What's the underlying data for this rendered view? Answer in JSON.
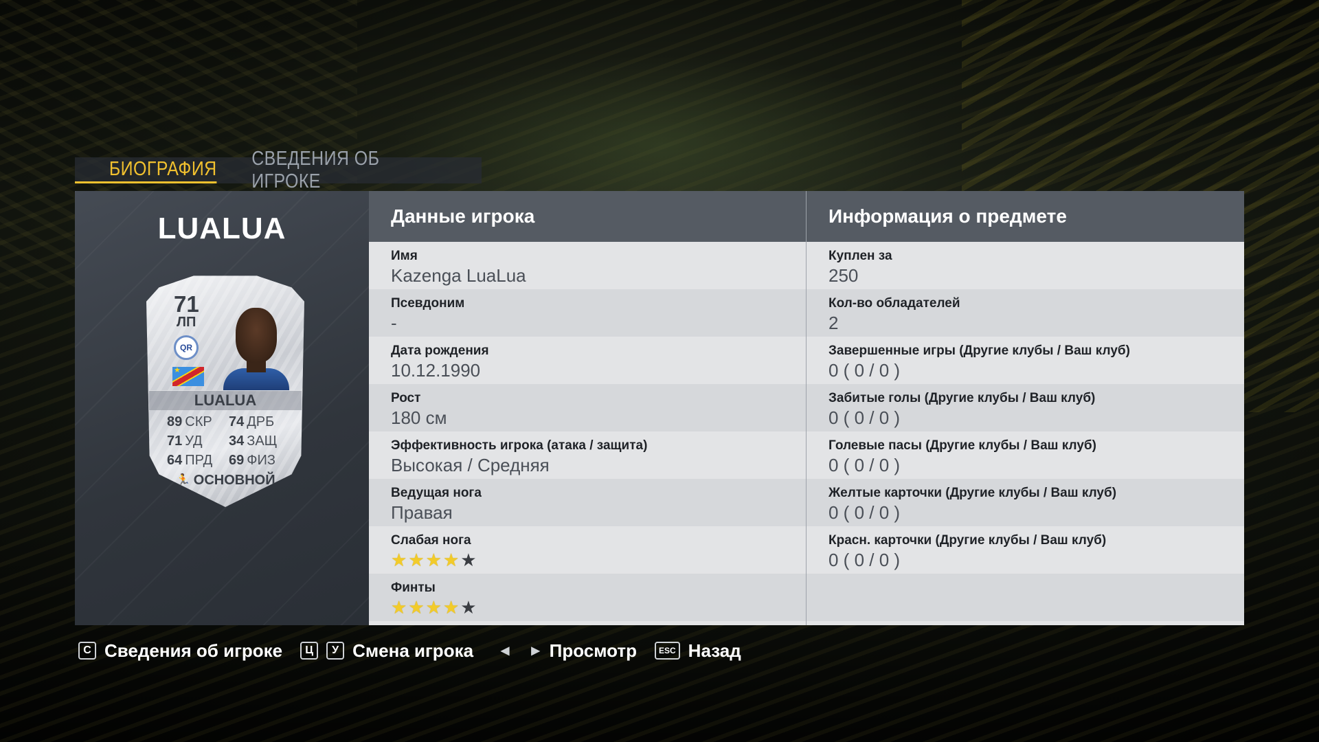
{
  "tabs": [
    {
      "label": "БИОГРАФИЯ",
      "active": true
    },
    {
      "label": "СВЕДЕНИЯ ОБ ИГРОКЕ",
      "active": false
    }
  ],
  "player": {
    "surname": "LUALUA"
  },
  "card": {
    "rating": "71",
    "position": "ЛП",
    "club_badge_text": "QR",
    "name": "LUALUA",
    "stats": [
      {
        "value": "89",
        "label": "СКР"
      },
      {
        "value": "74",
        "label": "ДРБ"
      },
      {
        "value": "71",
        "label": "УД"
      },
      {
        "value": "34",
        "label": "ЗАЩ"
      },
      {
        "value": "64",
        "label": "ПРД"
      },
      {
        "value": "69",
        "label": "ФИЗ"
      }
    ],
    "chemistry_style": "ОСНОВНОЙ"
  },
  "player_data": {
    "header": "Данные игрока",
    "rows": [
      {
        "label": "Имя",
        "value": "Kazenga LuaLua"
      },
      {
        "label": "Псевдоним",
        "value": "-"
      },
      {
        "label": "Дата рождения",
        "value": "10.12.1990"
      },
      {
        "label": "Рост",
        "value": "180 см"
      },
      {
        "label": "Эффективность игрока (атака / защита)",
        "value": "Высокая / Средняя"
      },
      {
        "label": "Ведущая нога",
        "value": "Правая"
      },
      {
        "label": "Слабая нога",
        "stars": 4,
        "max": 5
      },
      {
        "label": "Финты",
        "stars": 4,
        "max": 5
      }
    ]
  },
  "item_info": {
    "header": "Информация о предмете",
    "rows": [
      {
        "label": "Куплен за",
        "value": "250"
      },
      {
        "label": "Кол-во обладателей",
        "value": "2"
      },
      {
        "label": "Завершенные игры (Другие клубы / Ваш клуб)",
        "value": "0 ( 0 / 0 )"
      },
      {
        "label": "Забитые голы (Другие клубы / Ваш клуб)",
        "value": "0 ( 0 / 0 )"
      },
      {
        "label": "Голевые пасы (Другие клубы / Ваш клуб)",
        "value": "0 ( 0 / 0 )"
      },
      {
        "label": "Желтые карточки (Другие клубы / Ваш клуб)",
        "value": "0 ( 0 / 0 )"
      },
      {
        "label": "Красн. карточки (Другие клубы / Ваш клуб)",
        "value": "0 ( 0 / 0 )"
      },
      {
        "label": "",
        "value": ""
      }
    ]
  },
  "controls": {
    "info": {
      "key": "C",
      "label": "Сведения об игроке"
    },
    "switch": {
      "key1": "Ц",
      "key2": "У",
      "label": "Смена игрока"
    },
    "view": {
      "label": "Просмотр"
    },
    "back": {
      "key": "ESC",
      "label": "Назад"
    }
  },
  "colors": {
    "accent": "#f2c12e",
    "header_bg": "#555b63",
    "row_light": "#e3e4e6",
    "row_dark": "#d6d8db"
  }
}
